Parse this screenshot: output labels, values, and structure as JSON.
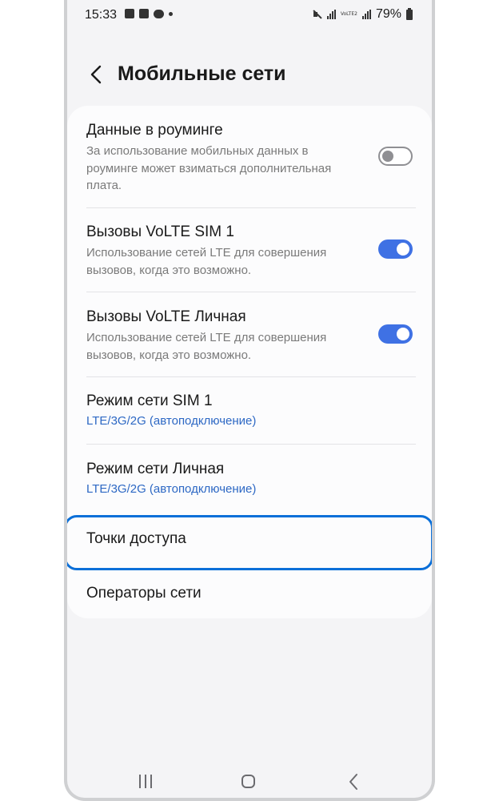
{
  "status_bar": {
    "time": "15:33",
    "battery": "79%",
    "volte_label": "VoLTE2",
    "icons": [
      "gallery-icon",
      "checklist-icon",
      "chat-icon",
      "dot-icon",
      "mute-icon",
      "signal-icon",
      "volte-icon",
      "signal-icon",
      "battery-icon"
    ]
  },
  "header": {
    "title": "Мобильные сети",
    "back_icon": "chevron-left-icon"
  },
  "settings": [
    {
      "title": "Данные в роуминге",
      "desc_lines": [
        "За использование мобильных данных в",
        "роуминге может взиматься дополнительная",
        "плата."
      ],
      "toggle": false
    },
    {
      "title": "Вызовы VoLTE SIM 1",
      "desc_lines": [
        "Использование сетей LTE для совершения",
        "вызовов, когда это возможно."
      ],
      "toggle": true
    },
    {
      "title": "Вызовы VoLTE Личная",
      "desc_lines": [
        "Использование сетей LTE для совершения",
        "вызовов, когда это возможно."
      ],
      "toggle": true
    },
    {
      "title": "Режим сети SIM 1",
      "value": "LTE/3G/2G (автоподключение)"
    },
    {
      "title": "Режим сети Личная",
      "value": "LTE/3G/2G (автоподключение)"
    },
    {
      "title": "Точки доступа",
      "highlighted": true
    },
    {
      "title": "Операторы сети"
    }
  ],
  "colors": {
    "accent": "#3f71e4",
    "value_text": "#2d68c4",
    "highlight_border": "#0b6fd8",
    "background": "#f4f4f6"
  },
  "navbar": {
    "icons": [
      "recent-apps-icon",
      "home-icon",
      "back-icon"
    ]
  }
}
